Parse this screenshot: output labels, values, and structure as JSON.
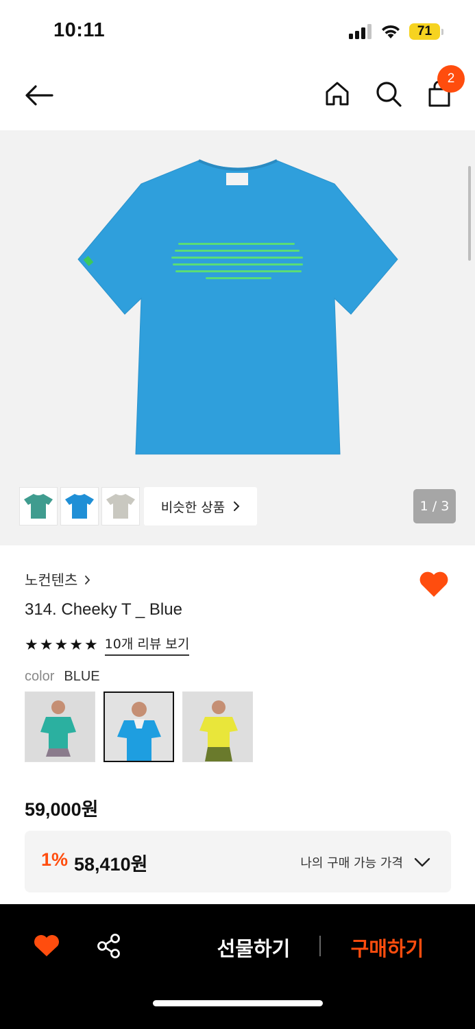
{
  "status": {
    "time": "10:11",
    "battery": "71"
  },
  "nav": {
    "cart_count": "2"
  },
  "gallery": {
    "similar_label": "비슷한 상품",
    "page_indicator": "1 / 3",
    "thumbnails": [
      "green-tee",
      "blue-tee",
      "gray-tee"
    ]
  },
  "product": {
    "brand": "노컨텐츠",
    "title": "314. Cheeky T _ Blue",
    "rating_stars": 5,
    "review_link": "10개 리뷰 보기",
    "color_label": "color",
    "color_value": "BLUE",
    "price": "59,000원",
    "discount_rate": "1%",
    "discount_price": "58,410원",
    "discount_label": "나의 구매 가능 가격"
  },
  "bottom_bar": {
    "gift_label": "선물하기",
    "buy_label": "구매하기"
  },
  "colors": {
    "accent": "#ff4d0e",
    "tee_blue": "#2f9fdc",
    "tee_green": "#3aa89a",
    "tee_gray": "#cfcfc8"
  }
}
